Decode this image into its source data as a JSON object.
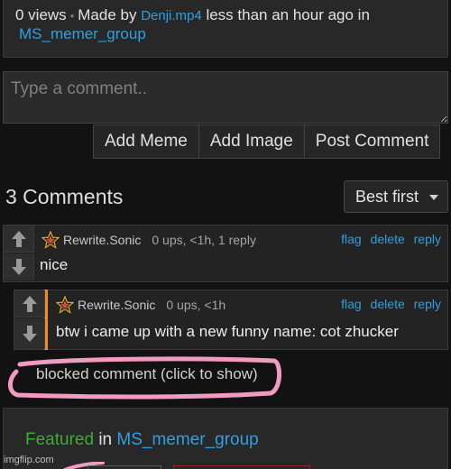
{
  "post_info": {
    "views": "0 views",
    "separator": "•",
    "made_by_prefix": "Made by",
    "author": "Denji.mp4",
    "time_suffix": "less than an hour ago in",
    "stream": "MS_memer_group"
  },
  "comment_form": {
    "placeholder": "Type a comment..",
    "buttons": [
      "Add Meme",
      "Add Image",
      "Post Comment"
    ]
  },
  "comments_header": {
    "count_label": "3 Comments",
    "sort_label": "Best first"
  },
  "comments": [
    {
      "username": "Rewrite.Sonic",
      "stats": "0 ups, <1h, 1 reply",
      "actions": [
        "flag",
        "delete",
        "reply"
      ],
      "text": "nice"
    },
    {
      "username": "Rewrite.Sonic",
      "stats": "0 ups, <1h",
      "actions": [
        "flag",
        "delete",
        "reply"
      ],
      "text": "btw i came up with a new funny name: cot zhucker"
    }
  ],
  "blocked_comment": "blocked comment (click to show)",
  "featured": {
    "word": "Featured",
    "in": "in",
    "stream": "MS_memer_group"
  },
  "watermark": "imgflip.com",
  "colors": {
    "link": "#2ea0e0",
    "featured_green": "#3faa36",
    "reply_accent": "#f08a24",
    "annotation_pink": "#f29ac0"
  }
}
